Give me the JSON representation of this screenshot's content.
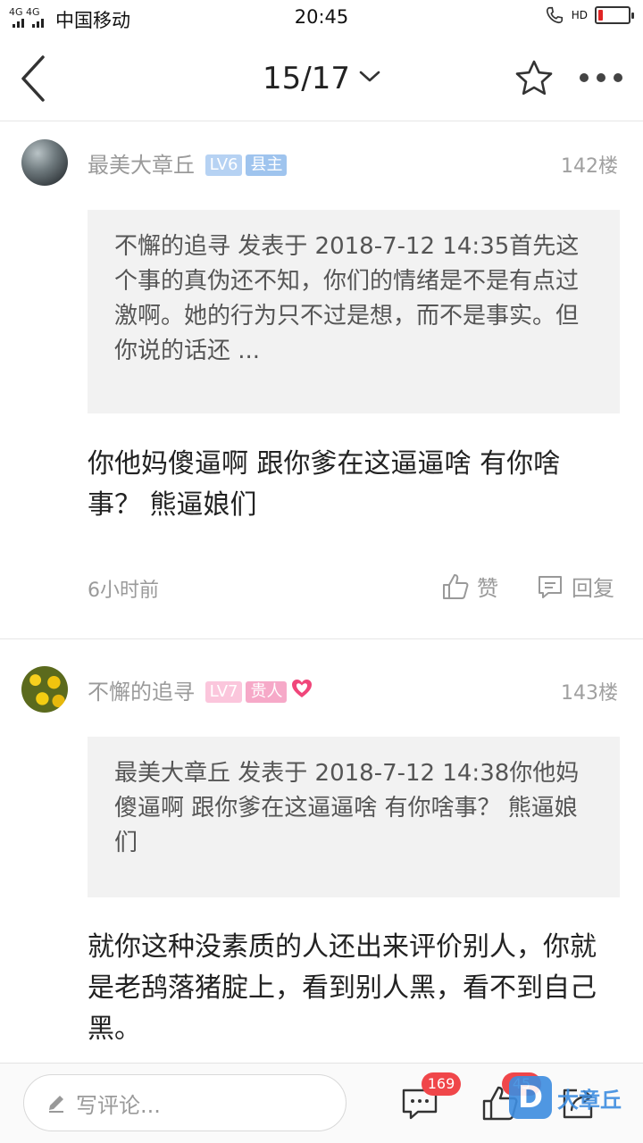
{
  "status_bar": {
    "signal": "4G 4G",
    "carrier": "中国移动",
    "time": "20:45",
    "hd": "HD",
    "battery_level": 0.15,
    "battery_color": "#e02424"
  },
  "nav": {
    "back_icon": "chevron-left-icon",
    "title": "15/17",
    "dropdown_icon": "chevron-down-icon",
    "favorite_icon": "star-icon",
    "more_icon": "more-dots-icon"
  },
  "posts": [
    {
      "username": "最美大章丘",
      "level": "LV6",
      "role": "县主",
      "floor": "142楼",
      "quote": "不懈的追寻 发表于 2018-7-12 14:35首先这个事的真伪还不知，你们的情绪是不是有点过激啊。她的行为只不过是想，而不是事实。但你说的话还 ...",
      "content": "你他妈傻逼啊 跟你爹在这逼逼啥 有你啥事？ 熊逼娘们",
      "time": "6小时前",
      "like_label": "赞",
      "reply_label": "回复"
    },
    {
      "username": "不懈的追寻",
      "level": "LV7",
      "role": "贵人",
      "floor": "143楼",
      "quote": "最美大章丘 发表于 2018-7-12 14:38你他妈傻逼啊 跟你爹在这逼逼啥 有你啥事？ 熊逼娘们",
      "content": "就你这种没素质的人还出来评价别人，你就是老鸹落猪腚上，看到别人黑，看不到自己黑。"
    }
  ],
  "bottom_bar": {
    "comment_placeholder": "写评论...",
    "comment_count": "169",
    "like_count": "45",
    "watermark": "大章丘"
  }
}
